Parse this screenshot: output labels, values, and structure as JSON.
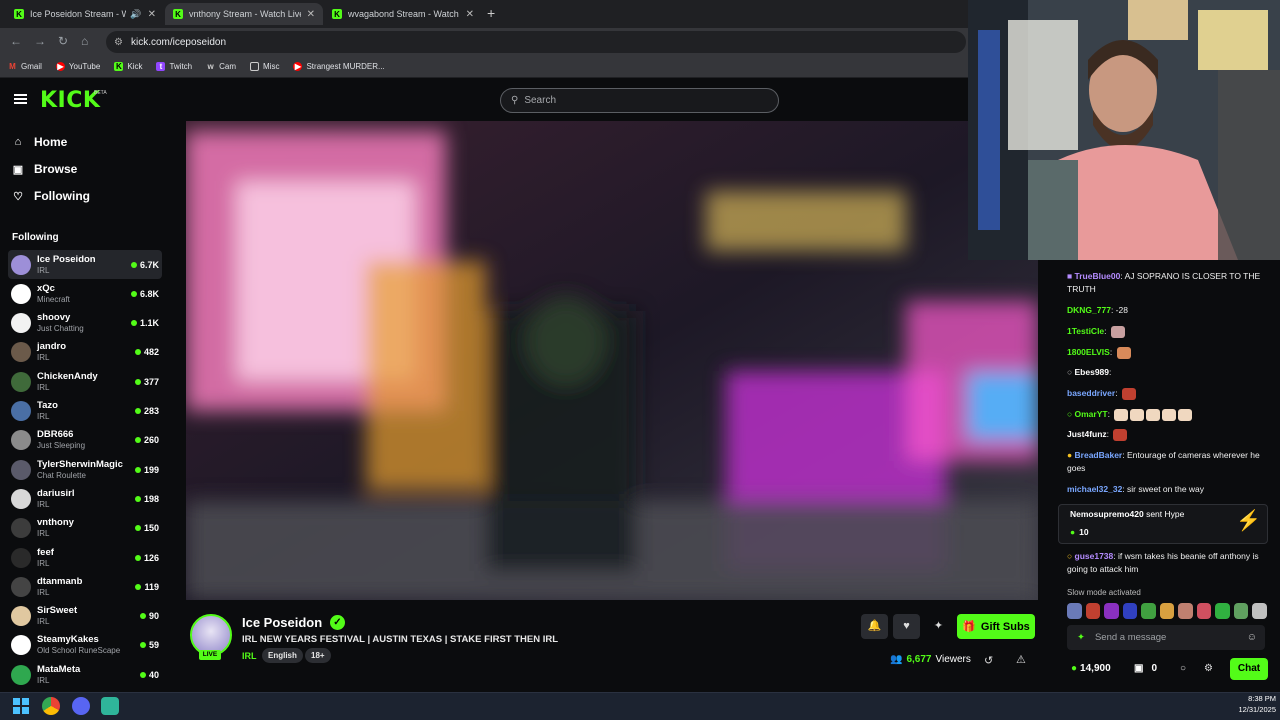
{
  "browser": {
    "tabs": [
      {
        "title": "Ice Poseidon Stream - Watch"
      },
      {
        "title": "vnthony Stream - Watch Live o"
      },
      {
        "title": "wvagabond Stream - Watch Liv"
      }
    ],
    "url": "kick.com/iceposeidon",
    "bookmarks": [
      {
        "label": "Gmail",
        "color": "#ea4335"
      },
      {
        "label": "YouTube",
        "color": "#ff0000"
      },
      {
        "label": "Kick",
        "color": "#53fc18"
      },
      {
        "label": "Twitch",
        "color": "#9146ff"
      },
      {
        "label": "Cam",
        "color": "#cccccc"
      },
      {
        "label": "Misc",
        "color": "#cccccc"
      },
      {
        "label": "Strangest MURDER...",
        "color": "#ff0000"
      }
    ]
  },
  "header": {
    "logo": "KICK",
    "beta": "BETA",
    "search_placeholder": "Search"
  },
  "sidebar": {
    "nav": [
      {
        "label": "Home",
        "icon": "home-icon"
      },
      {
        "label": "Browse",
        "icon": "browse-icon"
      },
      {
        "label": "Following",
        "icon": "heart-icon"
      }
    ],
    "following_title": "Following",
    "channels": [
      {
        "name": "Ice Poseidon",
        "category": "IRL",
        "viewers": "6.7K",
        "avatar": "#9d8fd8"
      },
      {
        "name": "xQc",
        "category": "Minecraft",
        "viewers": "6.8K",
        "avatar": "#ffffff"
      },
      {
        "name": "shoovy",
        "category": "Just Chatting",
        "viewers": "1.1K",
        "avatar": "#f2f2f2"
      },
      {
        "name": "jandro",
        "category": "IRL",
        "viewers": "482",
        "avatar": "#6b5a4a"
      },
      {
        "name": "ChickenAndy",
        "category": "IRL",
        "viewers": "377",
        "avatar": "#3f6a3a"
      },
      {
        "name": "Tazo",
        "category": "IRL",
        "viewers": "283",
        "avatar": "#4a6fa5"
      },
      {
        "name": "DBR666",
        "category": "Just Sleeping",
        "viewers": "260",
        "avatar": "#8b8b8b"
      },
      {
        "name": "TylerSherwinMagic",
        "category": "Chat Roulette",
        "viewers": "199",
        "avatar": "#5a5a6a"
      },
      {
        "name": "dariusirl",
        "category": "IRL",
        "viewers": "198",
        "avatar": "#d8d8d8"
      },
      {
        "name": "vnthony",
        "category": "IRL",
        "viewers": "150",
        "avatar": "#3c3c3c"
      },
      {
        "name": "feef",
        "category": "IRL",
        "viewers": "126",
        "avatar": "#2a2a2a"
      },
      {
        "name": "dtanmanb",
        "category": "IRL",
        "viewers": "119",
        "avatar": "#444444"
      },
      {
        "name": "SirSweet",
        "category": "IRL",
        "viewers": "90",
        "avatar": "#e0c8a0"
      },
      {
        "name": "SteamyKakes",
        "category": "Old School RuneScape",
        "viewers": "59",
        "avatar": "#ffffff"
      },
      {
        "name": "MataMeta",
        "category": "IRL",
        "viewers": "40",
        "avatar": "#2fa84f"
      }
    ]
  },
  "stream": {
    "channel": "Ice Poseidon",
    "live_badge": "LIVE",
    "title": "IRL NEW YEARS FESTIVAL | AUSTIN TEXAS | STAKE FIRST THEN IRL",
    "category": "IRL",
    "tags": [
      "English",
      "18+"
    ],
    "viewers": "6,677",
    "viewers_label": "Viewers",
    "gift_button": "Gift Subs"
  },
  "chat": {
    "messages": [
      {
        "user": "TrueBlue00",
        "color": "#b58cff",
        "text": ": AJ SOPRANO IS CLOSER TO THE TRUTH"
      },
      {
        "user": "DKNG_777",
        "color": "#53fc18",
        "text": ": -28"
      },
      {
        "user": "1TestiCle",
        "color": "#53fc18",
        "text": ":"
      },
      {
        "user": "1800ELVIS",
        "color": "#53fc18",
        "text": ":"
      },
      {
        "user": "Ebes989",
        "color": "#ffffff",
        "text": ":"
      },
      {
        "user": "baseddriver",
        "color": "#7aa7ff",
        "text": ":"
      },
      {
        "user": "OmarYT",
        "color": "#53fc18",
        "text": ":"
      },
      {
        "user": "Just4funz",
        "color": "#ffffff",
        "text": ":"
      },
      {
        "user": "BreadBaker",
        "color": "#7aa7ff",
        "text": ": Entourage of cameras wherever he goes"
      },
      {
        "user": "michael32_32",
        "color": "#7aa7ff",
        "text": ": sir sweet on the way"
      },
      {
        "user": "guse1738",
        "color": "#b58cff",
        "text": ": if wsm takes his beanie off anthony is going to attack him"
      }
    ],
    "hype_user": "Nemosupremo420",
    "hype_text": "sent Hype",
    "hype_count": "10",
    "slow_mode": "Slow mode activated",
    "input_placeholder": "Send a message",
    "balance": "14,900",
    "gifts": "0",
    "chat_button": "Chat"
  },
  "taskbar": {
    "time": "8:38 PM",
    "date": "12/31/2025"
  }
}
